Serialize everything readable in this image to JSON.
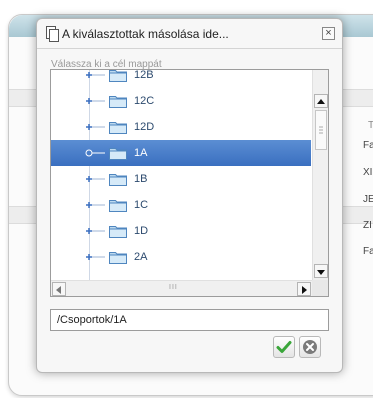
{
  "dialog": {
    "title": "A kiválasztottak másolása ide...",
    "hint": "Válassza ki a cél mappát",
    "path_value": "/Csoportok/1A",
    "colors": {
      "selection": "#3f74c4",
      "ok": "#3aa63a",
      "cancel": "#7a7a7a"
    }
  },
  "tree": {
    "items": [
      {
        "label": "12B",
        "selected": false
      },
      {
        "label": "12C",
        "selected": false
      },
      {
        "label": "12D",
        "selected": false
      },
      {
        "label": "1A",
        "selected": true
      },
      {
        "label": "1B",
        "selected": false
      },
      {
        "label": "1C",
        "selected": false
      },
      {
        "label": "1D",
        "selected": false
      },
      {
        "label": "2A",
        "selected": false
      }
    ]
  },
  "background": {
    "header_fragment": "T",
    "rows": [
      "Fa",
      "XI",
      "JE",
      "ZI",
      "Fa"
    ]
  },
  "icons": {
    "title": "copy-document-icon",
    "close": "close-icon",
    "ok": "checkmark-icon",
    "cancel": "cancel-icon",
    "folder": "folder-icon"
  }
}
